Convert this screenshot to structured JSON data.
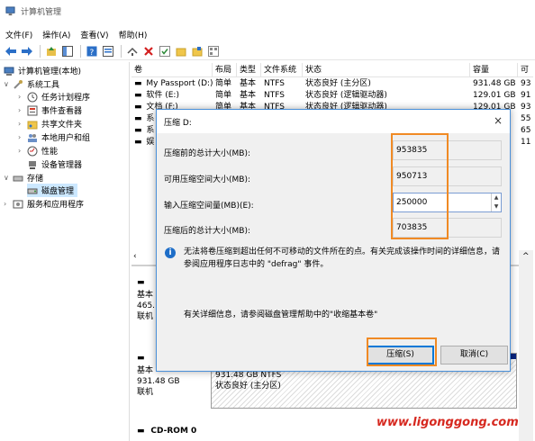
{
  "window": {
    "title": "计算机管理"
  },
  "menu": [
    "文件(F)",
    "操作(A)",
    "查看(V)",
    "帮助(H)"
  ],
  "tree": {
    "root": "计算机管理(本地)",
    "system_tools": "系统工具",
    "task_scheduler": "任务计划程序",
    "event_viewer": "事件查看器",
    "shared_folders": "共享文件夹",
    "local_users": "本地用户和组",
    "performance": "性能",
    "device_manager": "设备管理器",
    "storage": "存储",
    "disk_management": "磁盘管理",
    "services_apps": "服务和应用程序"
  },
  "columns": [
    "卷",
    "布局",
    "类型",
    "文件系统",
    "状态",
    "容量",
    "可"
  ],
  "volumes": [
    {
      "name": "My Passport (D:)",
      "layout": "简单",
      "type": "基本",
      "fs": "NTFS",
      "status": "状态良好 (主分区)",
      "capacity": "931.48 GB",
      "free": "93"
    },
    {
      "name": "软件 (E:)",
      "layout": "简单",
      "type": "基本",
      "fs": "NTFS",
      "status": "状态良好 (逻辑驱动器)",
      "capacity": "129.01 GB",
      "free": "91"
    },
    {
      "name": "文档 (F:)",
      "layout": "简单",
      "type": "基本",
      "fs": "NTFS",
      "status": "状态良好 (逻辑驱动器)",
      "capacity": "129.01 GB",
      "free": "93"
    },
    {
      "name": "系",
      "layout": "",
      "type": "",
      "fs": "",
      "status": "",
      "capacity": "",
      "free": "55"
    },
    {
      "name": "系",
      "layout": "",
      "type": "",
      "fs": "",
      "status": "",
      "capacity": "",
      "free": "65"
    },
    {
      "name": "娱",
      "layout": "",
      "type": "",
      "fs": "",
      "status": "",
      "capacity": "B",
      "free": "11"
    }
  ],
  "disk_pane": {
    "disk0": {
      "line1": "基本",
      "line2": "465.",
      "line3": "联机"
    },
    "disk1": {
      "line1": "基本",
      "line2": "931.48 GB",
      "line3": "联机"
    },
    "disk1_volume": {
      "line1": "931.48 GB NTFS",
      "line2": "状态良好 (主分区)"
    },
    "cdrom": "CD-ROM 0"
  },
  "dialog": {
    "title": "压缩 D:",
    "close": "×",
    "fields": [
      {
        "label": "压缩前的总计大小(MB):",
        "value": "953835"
      },
      {
        "label": "可用压缩空间大小(MB):",
        "value": "950713"
      },
      {
        "label": "输入压缩空间量(MB)(E):",
        "value": "250000"
      },
      {
        "label": "压缩后的总计大小(MB):",
        "value": "703835"
      }
    ],
    "info_text": "无法将卷压缩到超出任何不可移动的文件所在的点。有关完成该操作时间的详细信息，请参阅应用程序日志中的 \"defrag\" 事件。",
    "help_text": "有关详细信息，请参阅磁盘管理帮助中的\"收缩基本卷\"",
    "shrink_button": "压缩(S)",
    "cancel_button": "取消(C)"
  },
  "watermark": "www.ligonggong.com",
  "colors": {
    "accent": "#0078d7",
    "highlight": "#f08a24",
    "watermark": "#d6281f",
    "volume_bar": "#0b2580"
  }
}
